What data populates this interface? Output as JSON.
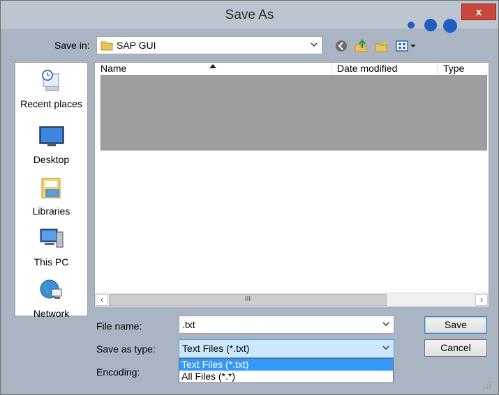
{
  "window": {
    "title": "Save As",
    "close_glyph": "x"
  },
  "toolbar": {
    "save_in_label": "Save in:",
    "save_in_value": "SAP GUI",
    "icons": [
      "back-icon",
      "up-folder-icon",
      "new-folder-icon",
      "view-menu-icon"
    ]
  },
  "places": [
    {
      "label": "Recent places",
      "icon": "recent-places-icon"
    },
    {
      "label": "Desktop",
      "icon": "desktop-icon"
    },
    {
      "label": "Libraries",
      "icon": "libraries-icon"
    },
    {
      "label": "This PC",
      "icon": "this-pc-icon"
    },
    {
      "label": "Network",
      "icon": "network-icon"
    }
  ],
  "file_list": {
    "columns": [
      "Name",
      "Date modified",
      "Type"
    ],
    "scroll_grip": "III"
  },
  "form": {
    "file_name_label": "File name:",
    "file_name_value": ".txt",
    "save_as_type_label": "Save as type:",
    "save_as_type_value": "Text Files (*.txt)",
    "encoding_label": "Encoding:",
    "type_options": [
      "Text Files (*.txt)",
      "All Files (*.*)"
    ]
  },
  "buttons": {
    "save": "Save",
    "cancel": "Cancel"
  },
  "colors": {
    "selection": "#3399ff",
    "close_button": "#c7473b",
    "dots": "#1f5fbf"
  }
}
